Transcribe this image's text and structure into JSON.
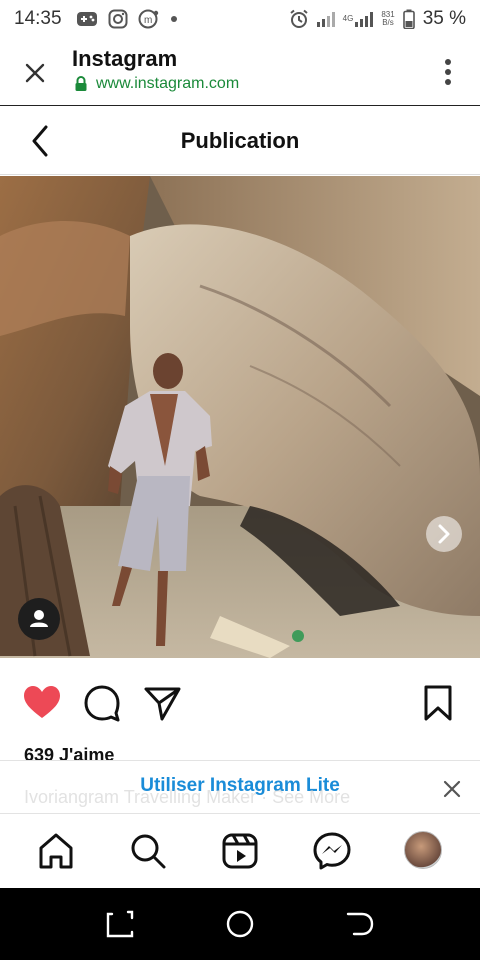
{
  "status_bar": {
    "time": "14:35",
    "network_label": "4G",
    "speed_value": "831",
    "speed_unit": "B/s",
    "battery": "35 %",
    "icons": [
      "game-controller-icon",
      "instagram-icon",
      "messenger-icon",
      "dot-icon",
      "alarm-icon",
      "signal-icon",
      "battery-icon"
    ]
  },
  "browser": {
    "title": "Instagram",
    "url": "www.instagram.com",
    "icons": [
      "close-icon",
      "lock-icon",
      "more-vertical-icon"
    ]
  },
  "header": {
    "title": "Publication"
  },
  "post": {
    "likes": "639 J'aime",
    "caption_hint": "Ivoriangram Travelling Maker · See More"
  },
  "banner": {
    "text": "Utiliser Instagram Lite"
  },
  "colors": {
    "like": "#ed4956",
    "lite_blue": "#1a8cd8",
    "url_green": "#1b8a3a"
  }
}
